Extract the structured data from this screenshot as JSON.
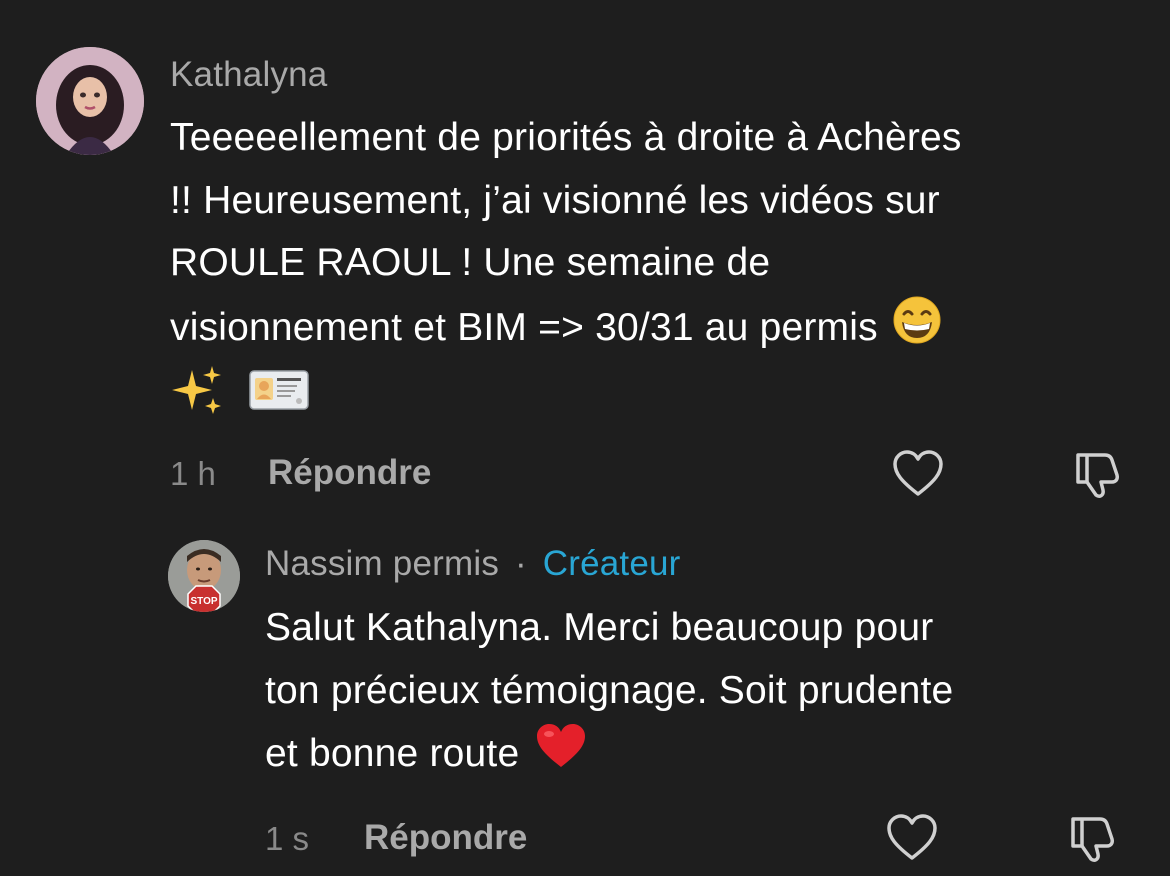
{
  "comments": [
    {
      "author": "Kathalyna",
      "lines": [
        "Teeeeellement de priorités à droite à Achères",
        "!! Heureusement, j’ai visionné les vidéos sur",
        "ROULE RAOUL ! Une semaine de",
        "visionnement et BIM => 30/31 au permis"
      ],
      "emojis": [
        "grinning-face-emoji",
        "sparkles-emoji",
        "id-card-emoji"
      ],
      "time": "1 h",
      "reply_label": "Répondre",
      "icons": [
        "heart-icon",
        "thumbs-down-icon"
      ]
    },
    {
      "author": "Nassim permis",
      "separator": "·",
      "badge": "Créateur",
      "lines": [
        "Salut Kathalyna. Merci beaucoup pour",
        "ton précieux témoignage. Soit prudente",
        "et bonne route"
      ],
      "emojis": [
        "red-heart-emoji"
      ],
      "avatar_sign": "STOP",
      "time": "1 s",
      "reply_label": "Répondre",
      "icons": [
        "heart-icon",
        "thumbs-down-icon"
      ]
    }
  ],
  "colors": {
    "background": "#1e1e1e",
    "author": "#a9a9a9",
    "creator_badge": "#29a6d4",
    "text": "#ffffff"
  }
}
